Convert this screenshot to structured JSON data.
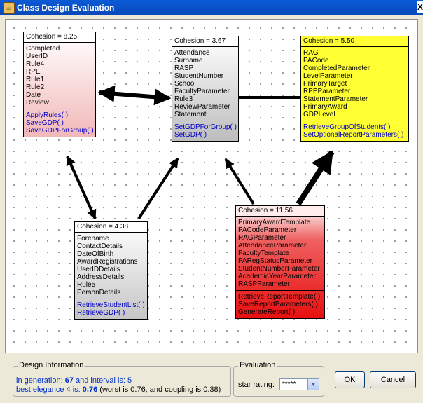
{
  "window": {
    "title": "Class Design Evaluation",
    "close_glyph": "X"
  },
  "classes": [
    {
      "cohesion": "Cohesion = 8.25",
      "attributes": [
        "Completed",
        "UserID",
        "Rule4",
        "RPE",
        "Rule1",
        "Rule2",
        "Date",
        "Review"
      ],
      "methods": [
        "ApplyRules( )",
        "SaveGDP( )",
        "SaveGDPForGroup( )"
      ],
      "color": "#f2b8b8"
    },
    {
      "cohesion": "Cohesion = 3.67",
      "attributes": [
        "Attendance",
        "Surname",
        "RASP",
        "StudentNumber",
        "School",
        "FacultyParameter",
        "Rule3",
        "ReviewParameter",
        "Statement"
      ],
      "methods": [
        "SetGDPForGroup( )",
        "SetGDP( )"
      ],
      "color": "#bdbdbd"
    },
    {
      "cohesion": "Cohesion = 5.50",
      "attributes": [
        "RAG",
        "PACode",
        "CompletedParameter",
        "LevelParameter",
        "PrimaryTarget",
        "RPEParameter",
        "StatementParameter",
        "PrimaryAward",
        "GDPLevel"
      ],
      "methods": [
        "RetrieveGroupOfStudents( )",
        "SetOptionalReportParameters( )"
      ],
      "color": "#ffff33"
    },
    {
      "cohesion": "Cohesion = 4.38",
      "attributes": [
        "Forename",
        "ContactDetails",
        "DateOfBirth",
        "AwardRegistrations",
        "UserIDDetails",
        "AddressDetails",
        "Rule5",
        "PersonDetails"
      ],
      "methods": [
        "RetrieveStudentList( )",
        "RetrieveGDP( )"
      ],
      "color": "#c6c6c6"
    },
    {
      "cohesion": "Cohesion = 11.56",
      "attributes": [
        "PrimaryAwardTemplate",
        "PACodeParameter",
        "RAGParameter",
        "AttendanceParameter",
        "FacultyTemplate",
        "PARegStatusParameter",
        "StudentNumberParameter",
        "AcademicYearParameter",
        "RASPParameter"
      ],
      "methods": [
        "RetrieveReportTemplate( )",
        "SaveReportParameters( )",
        "GenerateReport( )"
      ],
      "color": "#e81010"
    }
  ],
  "design_info": {
    "legend": "Design Information",
    "gen_prefix": "in generation: ",
    "gen_value": "67",
    "gen_suffix": " and interval is: 5",
    "elegance_prefix": "best elegance 4 is: ",
    "elegance_value": "0.76",
    "elegance_suffix": " (worst is 0.76, and coupling is 0.38)"
  },
  "evaluation": {
    "legend": "Evaluation",
    "star_label": "star rating:",
    "star_value": "*****"
  },
  "buttons": {
    "ok": "OK",
    "cancel": "Cancel"
  }
}
